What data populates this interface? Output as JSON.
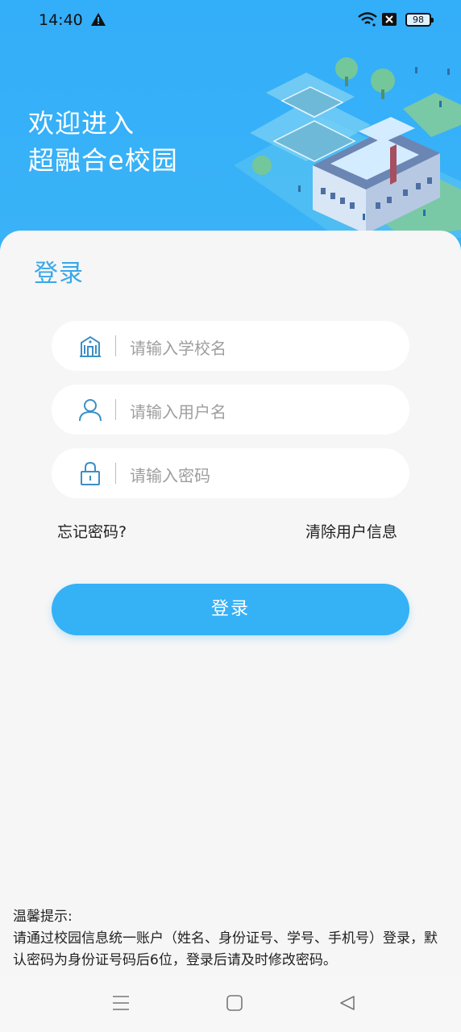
{
  "status": {
    "time": "14:40",
    "battery": "98",
    "icons": [
      "warning-icon",
      "wifi-icon",
      "close-box-icon",
      "battery-icon"
    ]
  },
  "hero": {
    "welcome_line1": "欢迎进入",
    "welcome_line2": "超融合e校园"
  },
  "login": {
    "title": "登录",
    "fields": [
      {
        "icon": "school-building-icon",
        "placeholder": "请输入学校名"
      },
      {
        "icon": "user-icon",
        "placeholder": "请输入用户名"
      },
      {
        "icon": "lock-icon",
        "placeholder": "请输入密码"
      }
    ],
    "forgot_password": "忘记密码?",
    "clear_user_info": "清除用户信息",
    "submit_label": "登录"
  },
  "tips": {
    "heading": "温馨提示:",
    "body": "请通过校园信息统一账户（姓名、身份证号、学号、手机号）登录，默认密码为身份证号码后6位，登录后请及时修改密码。"
  },
  "colors": {
    "accent": "#35b1f6",
    "title": "#3aa7e8",
    "background": "#f6f6f6"
  }
}
